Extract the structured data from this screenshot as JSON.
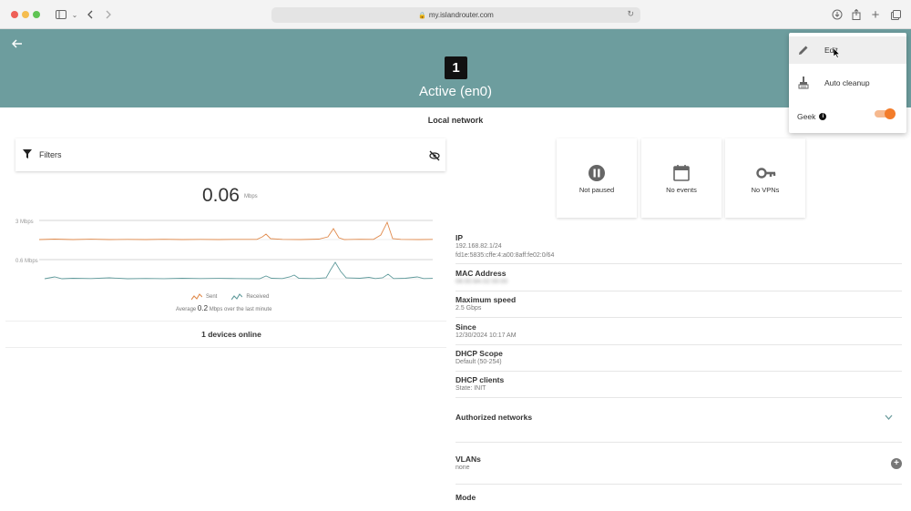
{
  "browser": {
    "url": "my.islandrouter.com"
  },
  "header": {
    "port_number": "1",
    "title": "Active (en0)"
  },
  "section_title": "Local network",
  "filters": {
    "label": "Filters"
  },
  "traffic": {
    "current_rate": "0.06",
    "current_unit": "Mbps",
    "sent_axis_label": "3 Mbps",
    "received_axis_label": "0.6 Mbps",
    "legend_sent": "Sent",
    "legend_received": "Received",
    "sent_color": "#e08a4c",
    "received_color": "#5f9a9b",
    "avg_prefix": "Average",
    "avg_value": "0.2",
    "avg_suffix": "Mbps over the last minute"
  },
  "devices_online": "1 devices online",
  "status_cards": [
    {
      "label": "Not paused",
      "icon": "pause-circle-icon"
    },
    {
      "label": "No events",
      "icon": "calendar-icon"
    },
    {
      "label": "No VPNs",
      "icon": "key-icon"
    }
  ],
  "details": {
    "ip_label": "IP",
    "ip_v4": "192.168.82.1/24",
    "ip_v6": "fd1e:5835:cffe:4:a00:8aff:fe02:0/64",
    "mac_label": "MAC Address",
    "mac_value": "08:00:8A:02:00:00",
    "speed_label": "Maximum speed",
    "speed_value": "2.5 Gbps",
    "since_label": "Since",
    "since_value": "12/30/2024 10:17 AM",
    "dhcp_scope_label": "DHCP Scope",
    "dhcp_scope_value": "Default (50-254)",
    "dhcp_clients_label": "DHCP clients",
    "dhcp_clients_value": "State: INIT",
    "authorized_label": "Authorized networks",
    "vlans_label": "VLANs",
    "vlans_value": "none",
    "mode_label": "Mode"
  },
  "menu": {
    "edit_label": "Edit",
    "auto_cleanup_label": "Auto cleanup",
    "geek_label": "Geek",
    "geek_enabled": true,
    "accent_color": "#f37c2a"
  },
  "colors": {
    "header_bg": "#6d9d9e"
  }
}
